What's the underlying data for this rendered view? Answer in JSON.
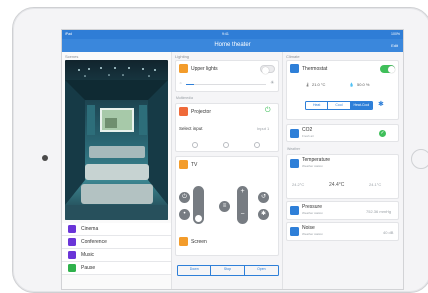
{
  "statusbar": {
    "left": "iPad",
    "time": "9:41",
    "right": "100%"
  },
  "nav": {
    "title": "Home theater",
    "edit": "Edit"
  },
  "scenes": {
    "header": "Scenes",
    "items": [
      {
        "label": "Cinema",
        "icon": "film-icon"
      },
      {
        "label": "Conference",
        "icon": "presentation-icon"
      },
      {
        "label": "Music",
        "icon": "music-icon"
      },
      {
        "label": "Pause",
        "icon": "pause-icon"
      }
    ]
  },
  "lighting": {
    "header": "Lighting",
    "upper_lights": {
      "label": "Upper lights",
      "on": false,
      "level": 0.1
    },
    "multimedia_header": "Multimedia",
    "projector": {
      "label": "Projector",
      "select_input": "Select input",
      "input_value": "Input 1"
    },
    "tv": {
      "label": "TV"
    },
    "screen": {
      "label": "Screen",
      "buttons": [
        "Down",
        "Stop",
        "Open"
      ]
    }
  },
  "climate": {
    "header": "Climate",
    "thermostat": {
      "label": "Thermostat",
      "on": true,
      "temperature": "21.0 °C",
      "humidity": "50.0 %",
      "modes": [
        "Heat",
        "Cool",
        "Heat-Cool"
      ],
      "active_mode": "Heat-Cool"
    },
    "co2": {
      "label": "CO2",
      "sub": "Fresh air"
    },
    "weather_header": "Weather",
    "temperature": {
      "label": "Temperature",
      "sub": "Weather station",
      "values": [
        "24.2°C",
        "24.4°C",
        "24.1°C"
      ]
    },
    "pressure": {
      "label": "Pressure",
      "sub": "Weather station",
      "value": "752.36 mmHg"
    },
    "noise": {
      "label": "Noise",
      "sub": "Weather station",
      "value": "40 dB"
    }
  },
  "colors": {
    "accent": "#2e7fd8",
    "orange": "#f39c2b",
    "green": "#3fbf5a",
    "purple": "#6a35d8"
  }
}
